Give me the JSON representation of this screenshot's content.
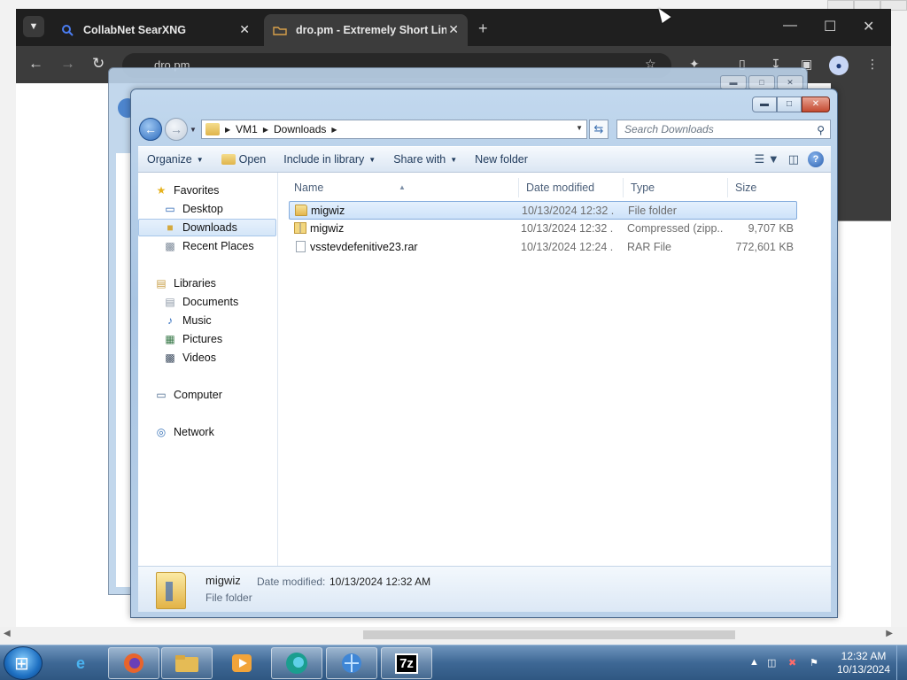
{
  "browser": {
    "tabs": [
      {
        "title": "CollabNet SearXNG",
        "icon": "search-icon"
      },
      {
        "title": "dro.pm - Extremely Short Links",
        "icon": "dropm-icon"
      }
    ],
    "address": "dro.pm",
    "new_tab": "+",
    "tab_close": "✕"
  },
  "explorer": {
    "breadcrumb": [
      "VM1",
      "Downloads"
    ],
    "search_placeholder": "Search Downloads",
    "toolbar": {
      "organize": "Organize",
      "open": "Open",
      "include_in_library": "Include in library",
      "share_with": "Share with",
      "new_folder": "New folder"
    },
    "nav": {
      "favorites": "Favorites",
      "desktop": "Desktop",
      "downloads": "Downloads",
      "recent_places": "Recent Places",
      "libraries": "Libraries",
      "documents": "Documents",
      "music": "Music",
      "pictures": "Pictures",
      "videos": "Videos",
      "computer": "Computer",
      "network": "Network"
    },
    "columns": {
      "name": "Name",
      "date": "Date modified",
      "type": "Type",
      "size": "Size"
    },
    "files": [
      {
        "name": "migwiz",
        "date": "10/13/2024 12:32 ...",
        "type": "File folder",
        "size": "",
        "icon": "folder-icon",
        "selected": true
      },
      {
        "name": "migwiz",
        "date": "10/13/2024 12:32 ...",
        "type": "Compressed (zipp...",
        "size": "9,707 KB",
        "icon": "zip-folder-icon",
        "selected": false
      },
      {
        "name": "vsstevdefenitive23.rar",
        "date": "10/13/2024 12:24 ...",
        "type": "RAR File",
        "size": "772,601 KB",
        "icon": "file-icon",
        "selected": false
      }
    ],
    "details": {
      "name": "migwiz",
      "date_label": "Date modified:",
      "date_value": "10/13/2024 12:32 AM",
      "type": "File folder"
    }
  },
  "taskbar": {
    "apps": [
      "ie-icon",
      "firefox-icon",
      "explorer-icon",
      "media-player-icon",
      "edge-icon",
      "network-icon",
      "7zip-icon"
    ],
    "seven_zip_label": "7z",
    "time": "12:32 AM",
    "date": "10/13/2024"
  }
}
